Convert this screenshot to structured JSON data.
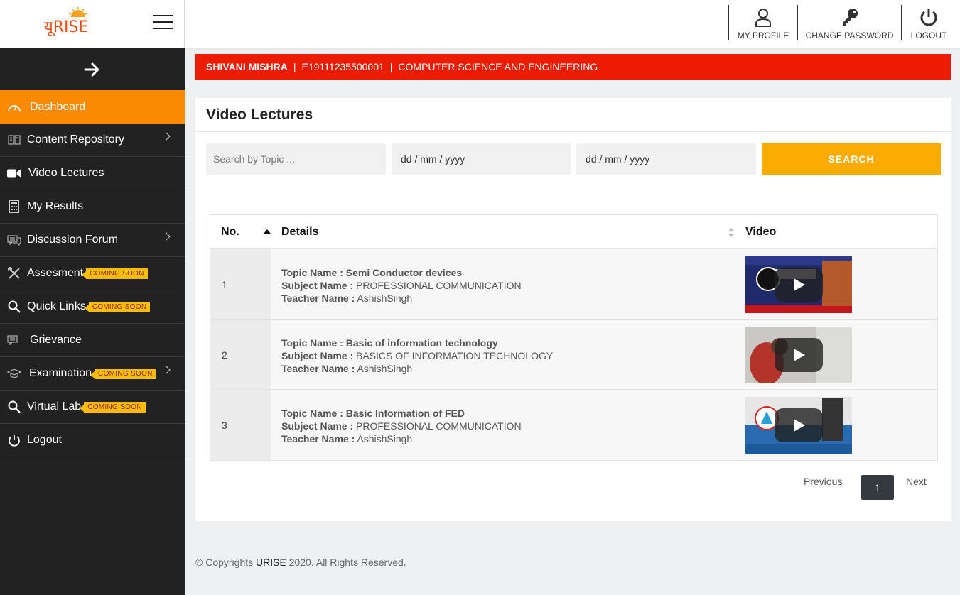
{
  "brand": {
    "logo_text": "यूRISE"
  },
  "header": {
    "actions": [
      {
        "label": "MY PROFILE",
        "icon": "user-icon"
      },
      {
        "label": "CHANGE PASSWORD",
        "icon": "key-icon"
      },
      {
        "label": "LOGOUT",
        "icon": "power-icon"
      }
    ]
  },
  "sidebar": {
    "items": [
      {
        "label": "Dashboard",
        "icon": "speedometer-icon",
        "active": true
      },
      {
        "label": "Content Repository",
        "icon": "book-icon",
        "has_submenu": true
      },
      {
        "label": "Video Lectures",
        "icon": "video-camera-icon"
      },
      {
        "label": "My Results",
        "icon": "calculator-icon"
      },
      {
        "label": "Discussion Forum",
        "icon": "chat-icon",
        "has_submenu": true
      },
      {
        "label": "Assesment",
        "icon": "tools-icon",
        "badge": "COMING SOON"
      },
      {
        "label": "Quick Links",
        "icon": "search-icon",
        "badge": "COMING SOON"
      },
      {
        "label": "Grievance",
        "icon": "chat-icon"
      },
      {
        "label": "Examination",
        "icon": "graduation-cap-icon",
        "badge": "COMING SOON",
        "has_submenu": true
      },
      {
        "label": "Virtual Lab",
        "icon": "search-icon",
        "badge": "COMING SOON"
      },
      {
        "label": "Logout",
        "icon": "power-icon"
      }
    ]
  },
  "student": {
    "name": "SHIVANI MISHRA",
    "sep1": "|",
    "enrollment": "E19111235500001",
    "sep2": "|",
    "department": "COMPUTER SCIENCE AND ENGINEERING"
  },
  "main": {
    "title": "Video Lectures",
    "search_placeholder": "Search by Topic ...",
    "from_date": "dd / mm / yyyy",
    "to_date": "dd / mm / yyyy",
    "search_label": "SEARCH",
    "table": {
      "headers": {
        "no": "No.",
        "details": "Details",
        "video": "Video"
      },
      "labels": {
        "topic": "Topic Name :",
        "subject": "Subject Name :",
        "teacher": "Teacher Name :"
      },
      "rows": [
        {
          "no": "1",
          "topic": "Semi Conductor devices",
          "subject": "PROFESSIONAL COMMUNICATION",
          "teacher": "AshishSingh"
        },
        {
          "no": "2",
          "topic": "Basic of information technology",
          "subject": "BASICS OF INFORMATION TECHNOLOGY",
          "teacher": "AshishSingh"
        },
        {
          "no": "3",
          "topic": "Basic Information of FED",
          "subject": "PROFESSIONAL COMMUNICATION",
          "teacher": "AshishSingh"
        }
      ]
    },
    "pagination": {
      "previous": "Previous",
      "current": "1",
      "next": "Next"
    }
  },
  "footer": {
    "prefix": "© Copyrights ",
    "brand": "URISE",
    "suffix": " 2020. All Rights Reserved."
  },
  "colors": {
    "sidebar": "#222222",
    "active": "#fb8a03",
    "student_bar": "#ec1c03",
    "search_button": "#fbab02",
    "badge": "#fbbd08"
  }
}
